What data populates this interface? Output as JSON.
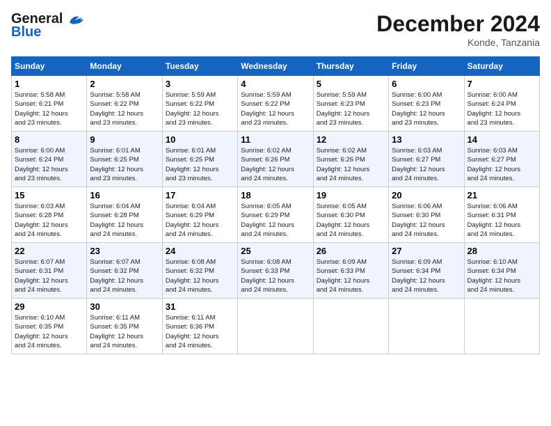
{
  "logo": {
    "line1": "General",
    "line2": "Blue"
  },
  "title": "December 2024",
  "location": "Konde, Tanzania",
  "days_of_week": [
    "Sunday",
    "Monday",
    "Tuesday",
    "Wednesday",
    "Thursday",
    "Friday",
    "Saturday"
  ],
  "weeks": [
    [
      {
        "day": "1",
        "info": "Sunrise: 5:58 AM\nSunset: 6:21 PM\nDaylight: 12 hours\nand 23 minutes."
      },
      {
        "day": "2",
        "info": "Sunrise: 5:58 AM\nSunset: 6:22 PM\nDaylight: 12 hours\nand 23 minutes."
      },
      {
        "day": "3",
        "info": "Sunrise: 5:59 AM\nSunset: 6:22 PM\nDaylight: 12 hours\nand 23 minutes."
      },
      {
        "day": "4",
        "info": "Sunrise: 5:59 AM\nSunset: 6:22 PM\nDaylight: 12 hours\nand 23 minutes."
      },
      {
        "day": "5",
        "info": "Sunrise: 5:59 AM\nSunset: 6:23 PM\nDaylight: 12 hours\nand 23 minutes."
      },
      {
        "day": "6",
        "info": "Sunrise: 6:00 AM\nSunset: 6:23 PM\nDaylight: 12 hours\nand 23 minutes."
      },
      {
        "day": "7",
        "info": "Sunrise: 6:00 AM\nSunset: 6:24 PM\nDaylight: 12 hours\nand 23 minutes."
      }
    ],
    [
      {
        "day": "8",
        "info": "Sunrise: 6:00 AM\nSunset: 6:24 PM\nDaylight: 12 hours\nand 23 minutes."
      },
      {
        "day": "9",
        "info": "Sunrise: 6:01 AM\nSunset: 6:25 PM\nDaylight: 12 hours\nand 23 minutes."
      },
      {
        "day": "10",
        "info": "Sunrise: 6:01 AM\nSunset: 6:25 PM\nDaylight: 12 hours\nand 23 minutes."
      },
      {
        "day": "11",
        "info": "Sunrise: 6:02 AM\nSunset: 6:26 PM\nDaylight: 12 hours\nand 24 minutes."
      },
      {
        "day": "12",
        "info": "Sunrise: 6:02 AM\nSunset: 6:26 PM\nDaylight: 12 hours\nand 24 minutes."
      },
      {
        "day": "13",
        "info": "Sunrise: 6:03 AM\nSunset: 6:27 PM\nDaylight: 12 hours\nand 24 minutes."
      },
      {
        "day": "14",
        "info": "Sunrise: 6:03 AM\nSunset: 6:27 PM\nDaylight: 12 hours\nand 24 minutes."
      }
    ],
    [
      {
        "day": "15",
        "info": "Sunrise: 6:03 AM\nSunset: 6:28 PM\nDaylight: 12 hours\nand 24 minutes."
      },
      {
        "day": "16",
        "info": "Sunrise: 6:04 AM\nSunset: 6:28 PM\nDaylight: 12 hours\nand 24 minutes."
      },
      {
        "day": "17",
        "info": "Sunrise: 6:04 AM\nSunset: 6:29 PM\nDaylight: 12 hours\nand 24 minutes."
      },
      {
        "day": "18",
        "info": "Sunrise: 6:05 AM\nSunset: 6:29 PM\nDaylight: 12 hours\nand 24 minutes."
      },
      {
        "day": "19",
        "info": "Sunrise: 6:05 AM\nSunset: 6:30 PM\nDaylight: 12 hours\nand 24 minutes."
      },
      {
        "day": "20",
        "info": "Sunrise: 6:06 AM\nSunset: 6:30 PM\nDaylight: 12 hours\nand 24 minutes."
      },
      {
        "day": "21",
        "info": "Sunrise: 6:06 AM\nSunset: 6:31 PM\nDaylight: 12 hours\nand 24 minutes."
      }
    ],
    [
      {
        "day": "22",
        "info": "Sunrise: 6:07 AM\nSunset: 6:31 PM\nDaylight: 12 hours\nand 24 minutes."
      },
      {
        "day": "23",
        "info": "Sunrise: 6:07 AM\nSunset: 6:32 PM\nDaylight: 12 hours\nand 24 minutes."
      },
      {
        "day": "24",
        "info": "Sunrise: 6:08 AM\nSunset: 6:32 PM\nDaylight: 12 hours\nand 24 minutes."
      },
      {
        "day": "25",
        "info": "Sunrise: 6:08 AM\nSunset: 6:33 PM\nDaylight: 12 hours\nand 24 minutes."
      },
      {
        "day": "26",
        "info": "Sunrise: 6:09 AM\nSunset: 6:33 PM\nDaylight: 12 hours\nand 24 minutes."
      },
      {
        "day": "27",
        "info": "Sunrise: 6:09 AM\nSunset: 6:34 PM\nDaylight: 12 hours\nand 24 minutes."
      },
      {
        "day": "28",
        "info": "Sunrise: 6:10 AM\nSunset: 6:34 PM\nDaylight: 12 hours\nand 24 minutes."
      }
    ],
    [
      {
        "day": "29",
        "info": "Sunrise: 6:10 AM\nSunset: 6:35 PM\nDaylight: 12 hours\nand 24 minutes."
      },
      {
        "day": "30",
        "info": "Sunrise: 6:11 AM\nSunset: 6:35 PM\nDaylight: 12 hours\nand 24 minutes."
      },
      {
        "day": "31",
        "info": "Sunrise: 6:11 AM\nSunset: 6:36 PM\nDaylight: 12 hours\nand 24 minutes."
      },
      {
        "day": "",
        "info": ""
      },
      {
        "day": "",
        "info": ""
      },
      {
        "day": "",
        "info": ""
      },
      {
        "day": "",
        "info": ""
      }
    ]
  ]
}
